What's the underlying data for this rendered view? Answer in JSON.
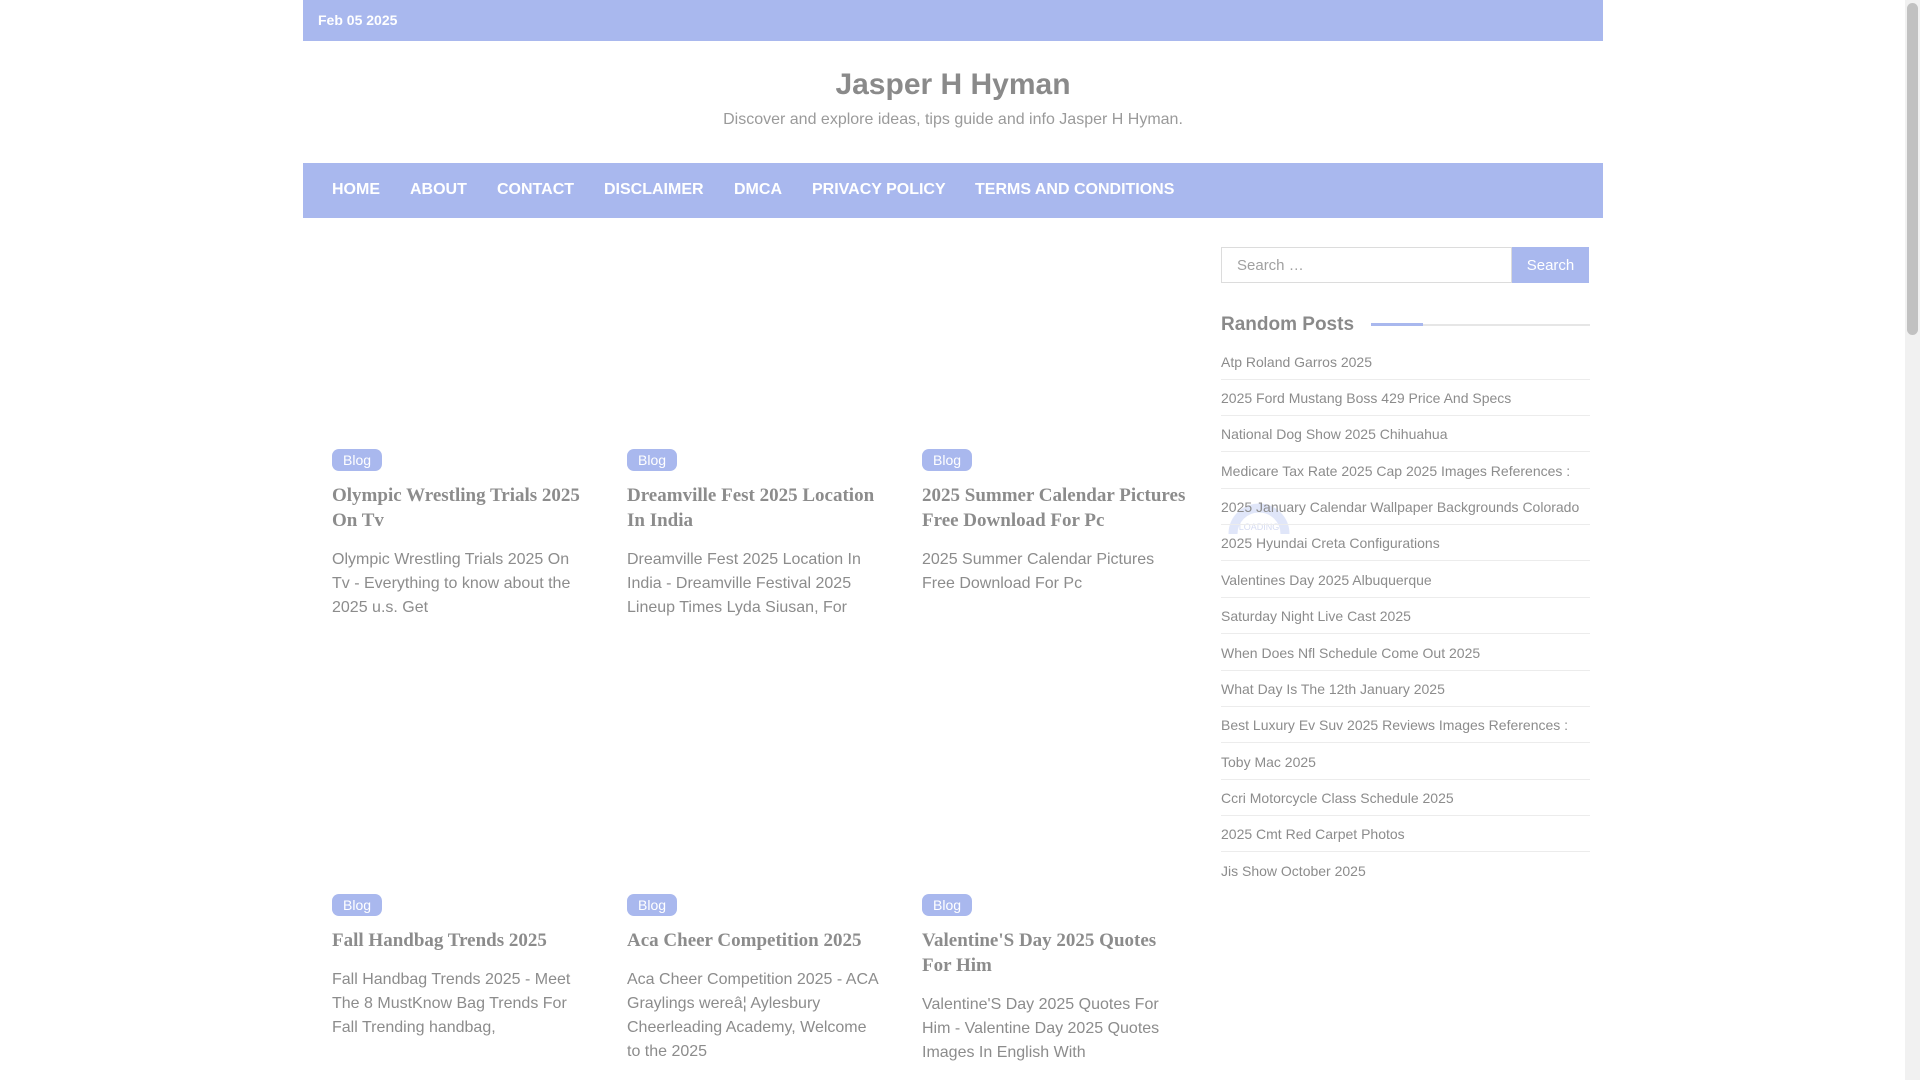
{
  "topbar": {
    "date": "Feb 05 2025"
  },
  "site": {
    "title": "Jasper H Hyman",
    "description": "Discover and explore ideas, tips guide and info Jasper H Hyman."
  },
  "nav": {
    "items": [
      "HOME",
      "ABOUT",
      "CONTACT",
      "DISCLAIMER",
      "DMCA",
      "PRIVACY POLICY",
      "TERMS AND CONDITIONS"
    ]
  },
  "posts": [
    {
      "category": "Blog",
      "title": "Olympic Wrestling Trials 2025 On Tv",
      "excerpt": "Olympic Wrestling Trials 2025 On Tv - Everything to know about the 2025 u.s. Get"
    },
    {
      "category": "Blog",
      "title": "Dreamville Fest 2025 Location In India",
      "excerpt": "Dreamville Fest 2025 Location In India - Dreamville Festival 2025 Lineup Times Lyda Siusan, For"
    },
    {
      "category": "Blog",
      "title": "2025 Summer Calendar Pictures Free Download For Pc",
      "excerpt": "2025 Summer Calendar Pictures Free Download For Pc"
    },
    {
      "category": "Blog",
      "title": "Fall Handbag Trends 2025",
      "excerpt": "Fall Handbag Trends 2025 - Meet The 8 MustKnow Bag Trends For Fall Trending handbag,"
    },
    {
      "category": "Blog",
      "title": "Aca Cheer Competition 2025",
      "excerpt": "Aca Cheer Competition 2025 - ACA Graylings wereâ¦ Aylesbury Cheerleading Academy, Welcome to the 2025"
    },
    {
      "category": "Blog",
      "title": "Valentine'S Day 2025 Quotes For Him",
      "excerpt": "Valentine'S Day 2025 Quotes For Him - Valentine Day 2025 Quotes Images In English With"
    }
  ],
  "loader": {
    "label": "LOADING"
  },
  "sidebar": {
    "search": {
      "placeholder": "Search …",
      "button": "Search"
    },
    "random_posts": {
      "title": "Random Posts",
      "items": [
        "Atp Roland Garros 2025",
        "2025 Ford Mustang Boss 429 Price And Specs",
        "National Dog Show 2025 Chihuahua",
        "Medicare Tax Rate 2025 Cap 2025 Images References :",
        "2025 January Calendar Wallpaper Backgrounds Colorado",
        "2025 Hyundai Creta Configurations",
        "Valentines Day 2025 Albuquerque",
        "Saturday Night Live Cast 2025",
        "When Does Nfl Schedule Come Out 2025",
        "What Day Is The 12th January 2025",
        "Best Luxury Ev Suv 2025 Reviews Images References :",
        "Toby Mac 2025",
        "Ccri Motorcycle Class Schedule 2025",
        "2025 Cmt Red Carpet Photos",
        "Jis Show October 2025"
      ]
    }
  },
  "colors": {
    "accent": "#a9b8ee",
    "text": "#8c8c8c"
  }
}
